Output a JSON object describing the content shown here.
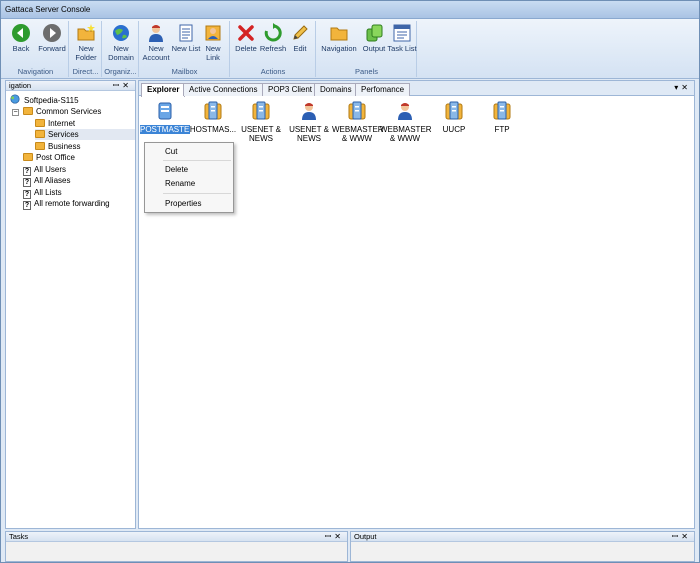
{
  "window": {
    "title": "Gattaca Server Console"
  },
  "ribbon": {
    "groups": [
      {
        "caption": "Navigation",
        "buttons": [
          {
            "label": "Back",
            "icon": "back-arrow-icon"
          },
          {
            "label": "Forward",
            "icon": "forward-arrow-icon"
          }
        ]
      },
      {
        "caption": "Direct...",
        "buttons": [
          {
            "label": "New Folder",
            "icon": "new-folder-icon"
          }
        ]
      },
      {
        "caption": "Organiz...",
        "buttons": [
          {
            "label": "New Domain",
            "icon": "globe-icon"
          }
        ]
      },
      {
        "caption": "Mailbox",
        "buttons": [
          {
            "label": "New Account",
            "icon": "user-icon"
          },
          {
            "label": "New List",
            "icon": "list-icon"
          },
          {
            "label": "New Link",
            "icon": "link-icon"
          }
        ]
      },
      {
        "caption": "Actions",
        "buttons": [
          {
            "label": "Delete",
            "icon": "delete-x-icon"
          },
          {
            "label": "Refresh",
            "icon": "refresh-icon"
          },
          {
            "label": "Edit",
            "icon": "pencil-icon"
          }
        ]
      },
      {
        "caption": "Panels",
        "buttons": [
          {
            "label": "Navigation",
            "icon": "folder-icon"
          },
          {
            "label": "Output",
            "icon": "output-icon"
          },
          {
            "label": "Task List",
            "icon": "task-list-icon"
          }
        ]
      }
    ]
  },
  "navigation_pane": {
    "title": "igation",
    "tree": [
      {
        "label": "Softpedia-S115",
        "level": 0,
        "icon": "server-icon"
      },
      {
        "label": "Common Services",
        "level": 1,
        "icon": "folder-icon"
      },
      {
        "label": "Internet",
        "level": 2,
        "icon": "folder-icon"
      },
      {
        "label": "Services",
        "level": 2,
        "icon": "folder-icon"
      },
      {
        "label": "Business",
        "level": 2,
        "icon": "folder-icon"
      },
      {
        "label": "Post Office",
        "level": 1,
        "icon": "folder-icon"
      },
      {
        "label": "All Users",
        "level": 1,
        "icon": "question-icon"
      },
      {
        "label": "All Aliases",
        "level": 1,
        "icon": "question-icon"
      },
      {
        "label": "All Lists",
        "level": 1,
        "icon": "question-icon"
      },
      {
        "label": "All remote forwarding",
        "level": 1,
        "icon": "question-icon"
      }
    ]
  },
  "main": {
    "tabs": [
      "Explorer",
      "Active Connections",
      "POP3 Client",
      "Domains",
      "Perfomance"
    ],
    "items": [
      {
        "label": "POSTMASTER",
        "icon": "server-icon",
        "selected": true
      },
      {
        "label": "HOSTMAS...",
        "icon": "server-icon"
      },
      {
        "label": "USENET & NEWS",
        "icon": "server-icon"
      },
      {
        "label": "USENET & NEWS",
        "icon": "user-icon"
      },
      {
        "label": "WEBMASTER & WWW",
        "icon": "server-icon"
      },
      {
        "label": "WEBMASTER & WWW",
        "icon": "user-icon"
      },
      {
        "label": "UUCP",
        "icon": "server-icon"
      },
      {
        "label": "FTP",
        "icon": "server-icon"
      }
    ],
    "context_menu": [
      "Cut",
      "Delete",
      "Rename",
      "Properties"
    ]
  },
  "bottom_panes": {
    "tasks": "Tasks",
    "output": "Output"
  },
  "colors": {
    "selection": "#3b84d6",
    "ribbon_text": "#1e3a66",
    "caption": "#3b5a86"
  }
}
